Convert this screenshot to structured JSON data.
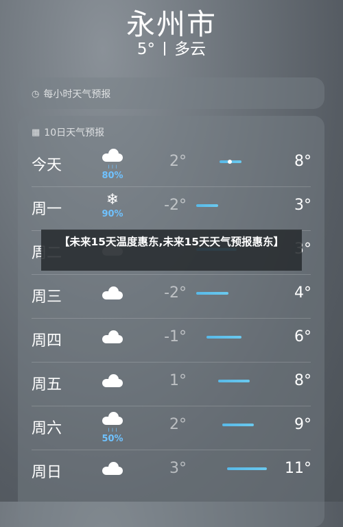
{
  "header": {
    "city": "永州市",
    "current_temp": "5°",
    "condition": "多云"
  },
  "hourly": {
    "icon": "clock-icon",
    "title": "每小时天气预报"
  },
  "daily": {
    "icon": "calendar-icon",
    "title": "10日天气预报",
    "rows": [
      {
        "day": "今天",
        "icon": "cloud-rain-icon",
        "precip": "80%",
        "low": "2°",
        "high": "8°",
        "range": [
          0.35,
          0.6
        ],
        "current": 0.47
      },
      {
        "day": "周一",
        "icon": "snowflake-icon",
        "precip": "90%",
        "low": "-2°",
        "high": "3°",
        "range": [
          0.08,
          0.33
        ]
      },
      {
        "day": "周二",
        "icon": "cloud-icon",
        "precip": "",
        "low": "",
        "high": "3°",
        "range": [
          0.08,
          0.55
        ]
      },
      {
        "day": "周三",
        "icon": "cloud-icon",
        "precip": "",
        "low": "-2°",
        "high": "4°",
        "range": [
          0.08,
          0.45
        ]
      },
      {
        "day": "周四",
        "icon": "cloud-icon",
        "precip": "",
        "low": "-1°",
        "high": "6°",
        "range": [
          0.2,
          0.6
        ]
      },
      {
        "day": "周五",
        "icon": "cloud-icon",
        "precip": "",
        "low": "1°",
        "high": "8°",
        "range": [
          0.33,
          0.7
        ]
      },
      {
        "day": "周六",
        "icon": "cloud-rain-icon",
        "precip": "50%",
        "low": "2°",
        "high": "9°",
        "range": [
          0.38,
          0.75
        ]
      },
      {
        "day": "周日",
        "icon": "cloud-icon",
        "precip": "",
        "low": "3°",
        "high": "11°",
        "range": [
          0.44,
          0.9
        ]
      }
    ]
  },
  "banner": {
    "text": "【未来15天温度惠东,未来15天天气预报惠东】"
  }
}
